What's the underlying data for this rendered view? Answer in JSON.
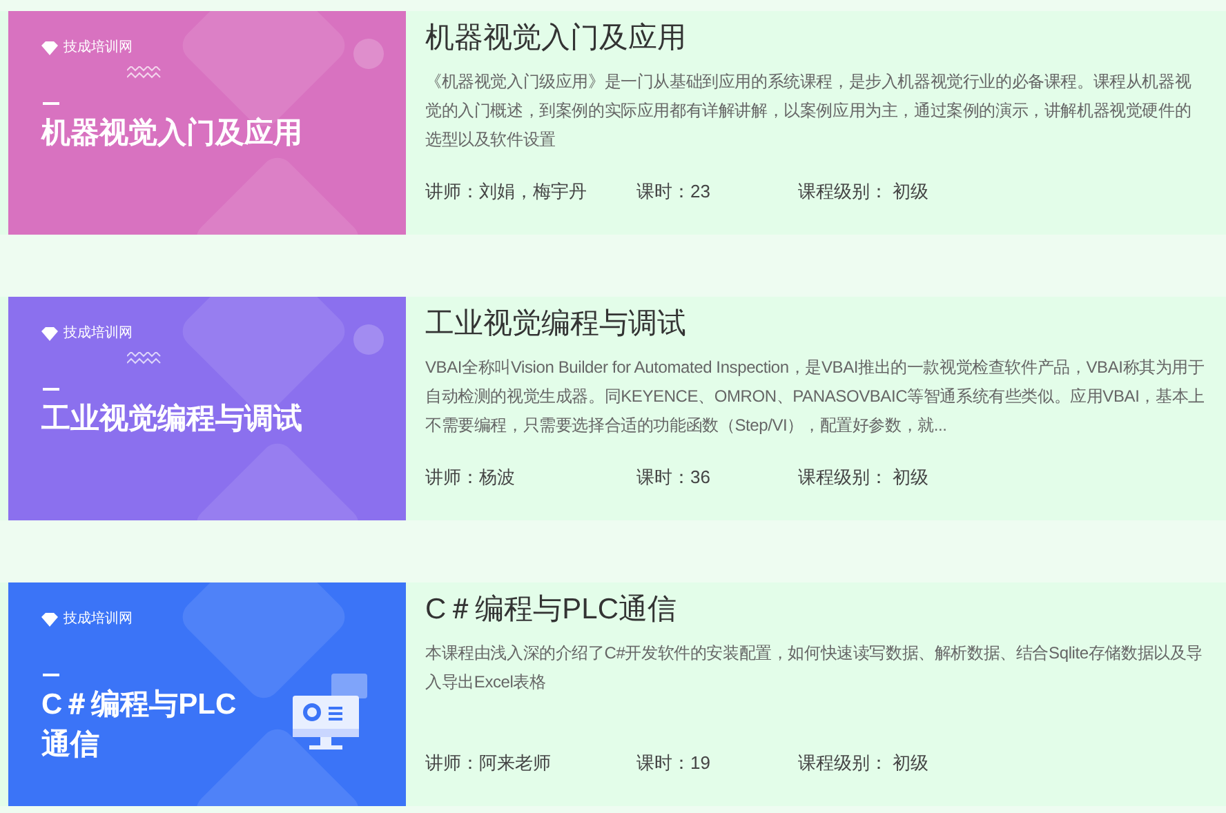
{
  "courses": [
    {
      "cover": {
        "color": "#d872c0",
        "logo": "技成培训网",
        "title_lines": [
          "机器视觉入门及应用"
        ],
        "kind": "waves"
      },
      "title": "机器视觉入门及应用",
      "description": "《机器视觉入门级应用》是一门从基础到应用的系统课程，是步入机器视觉行业的必备课程。课程从机器视觉的入门概述，到案例的实际应用都有详解讲解，以案例应用为主，通过案例的演示，讲解机器视觉硬件的选型以及软件设置",
      "teacher": "讲师：刘娟，梅宇丹",
      "hours": "课时：23",
      "level_label": "课程级别： 初级"
    },
    {
      "cover": {
        "color": "#8b70ee",
        "logo": "技成培训网",
        "title_lines": [
          "工业视觉编程与调试"
        ],
        "kind": "waves"
      },
      "title": "工业视觉编程与调试",
      "description": "VBAI全称叫Vision Builder for Automated Inspection，是VBAI推出的一款视觉检查软件产品，VBAI称其为用于自动检测的视觉生成器。同KEYENCE、OMRON、PANASOVBAIC等智通系统有些类似。应用VBAI，基本上不需要编程，只需要选择合适的功能函数（Step/VI），配置好参数，就...",
      "teacher": "讲师：杨波",
      "hours": "课时：36",
      "level_label": "课程级别： 初级"
    },
    {
      "cover": {
        "color": "#3b74f7",
        "logo": "技成培训网",
        "title_lines": [
          "C＃编程与PLC",
          "通信"
        ],
        "kind": "monitor"
      },
      "title": "C＃编程与PLC通信",
      "description": "本课程由浅入深的介绍了C#开发软件的安装配置，如何快速读写数据、解析数据、结合Sqlite存储数据以及导入导出Excel表格",
      "teacher": "讲师：阿来老师",
      "hours": "课时：19",
      "level_label": "课程级别： 初级"
    }
  ]
}
